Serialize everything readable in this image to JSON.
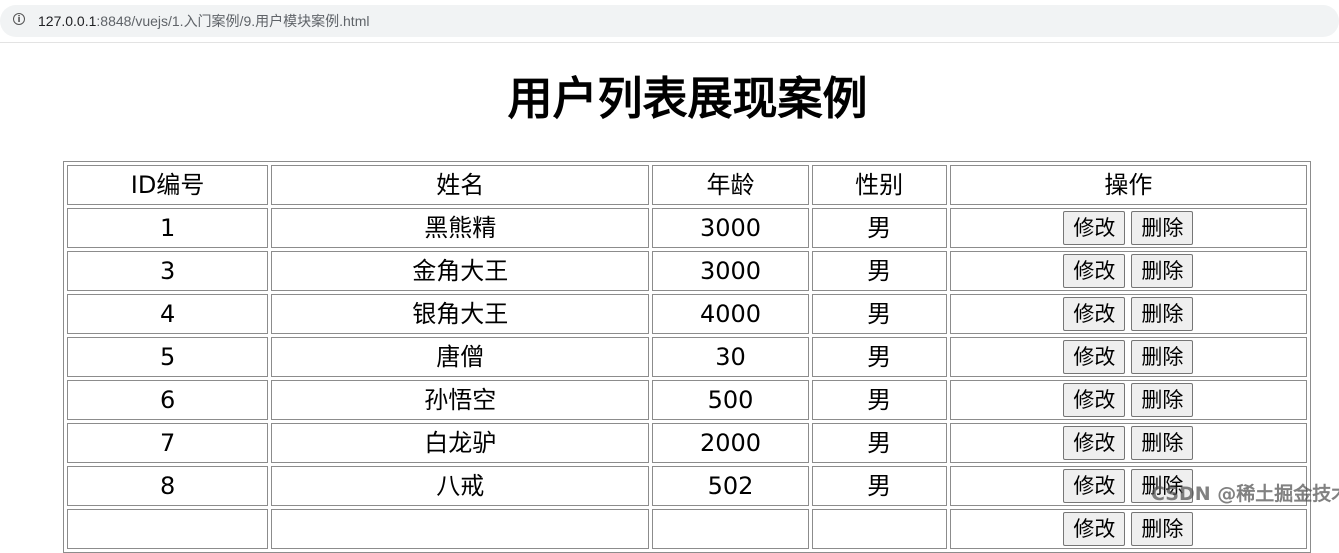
{
  "browser": {
    "url_host": "127.0.0.1",
    "url_path": ":8848/vuejs/1.入门案例/9.用户模块案例.html",
    "info_icon": "info-icon"
  },
  "page": {
    "title": "用户列表展现案例"
  },
  "table": {
    "headers": [
      "ID编号",
      "姓名",
      "年龄",
      "性别",
      "操作"
    ],
    "action_labels": {
      "edit": "修改",
      "delete": "删除"
    },
    "rows": [
      {
        "id": "1",
        "name": "黑熊精",
        "age": "3000",
        "gender": "男"
      },
      {
        "id": "3",
        "name": "金角大王",
        "age": "3000",
        "gender": "男"
      },
      {
        "id": "4",
        "name": "银角大王",
        "age": "4000",
        "gender": "男"
      },
      {
        "id": "5",
        "name": "唐僧",
        "age": "30",
        "gender": "男"
      },
      {
        "id": "6",
        "name": "孙悟空",
        "age": "500",
        "gender": "男"
      },
      {
        "id": "7",
        "name": "白龙驴",
        "age": "2000",
        "gender": "男"
      },
      {
        "id": "8",
        "name": "八戒",
        "age": "502",
        "gender": "男"
      },
      {
        "id": "",
        "name": "",
        "age": "",
        "gender": ""
      }
    ]
  },
  "watermark": {
    "text": "CSDN @稀土掘金技术社区"
  }
}
